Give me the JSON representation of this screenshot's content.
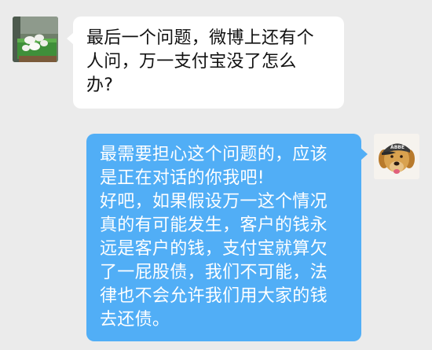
{
  "conversation": {
    "incoming": {
      "avatar_icon": "garden-eggs-avatar",
      "lines": [
        "最后一个问题，微博上还有个",
        "人问，万一支付宝没了怎么",
        "办?"
      ]
    },
    "outgoing": {
      "avatar_icon": "dog-with-cap-avatar",
      "avatar_cap_text": "ABBE",
      "lines": [
        "最需要担心这个问题的，应该",
        "是正在对话的你我吧!",
        "好吧，如果假设万一这个情况",
        "真的有可能发生，客户的钱永",
        "远是客户的钱，支付宝就算欠",
        "了一屁股债，我们不可能，法",
        "律也不会允许我们用大家的钱",
        "去还债。"
      ]
    }
  },
  "colors": {
    "background": "#ebebeb",
    "incoming_bubble": "#ffffff",
    "outgoing_bubble": "#51aef6",
    "outgoing_text": "#ffffff",
    "incoming_text": "#111111"
  }
}
